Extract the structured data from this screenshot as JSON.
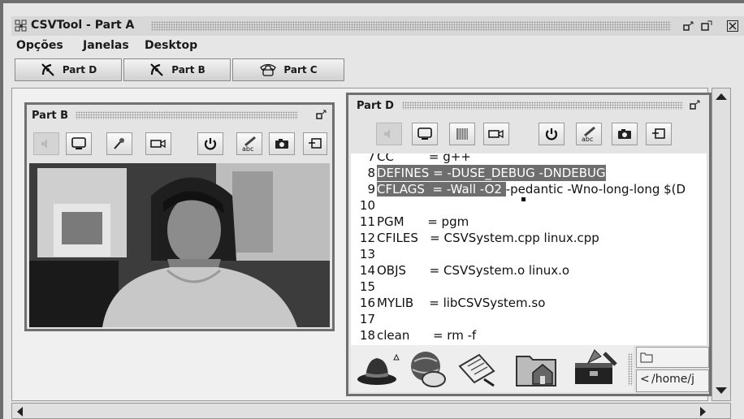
{
  "app": {
    "title": "CSVTool - Part A"
  },
  "menu": {
    "items": [
      {
        "label": "Opções"
      },
      {
        "label": "Janelas"
      },
      {
        "label": "Desktop"
      }
    ]
  },
  "tabs": [
    {
      "label": "Part D",
      "icon": "satellite-dish-icon"
    },
    {
      "label": "Part B",
      "icon": "satellite-dish-icon"
    },
    {
      "label": "Part C",
      "icon": "phone-icon"
    }
  ],
  "partB": {
    "title": "Part B",
    "tools": [
      "speaker-icon",
      "monitor-icon",
      "microphone-icon",
      "camera-icon",
      "power-icon",
      "spellcheck-icon",
      "snapshot-icon",
      "exit-icon"
    ]
  },
  "partD": {
    "title": "Part D",
    "tools": [
      "speaker-icon",
      "monitor-icon",
      "piano-icon",
      "camera-icon",
      "power-icon",
      "spellcheck-icon",
      "snapshot-icon",
      "exit-icon"
    ],
    "lines": [
      {
        "num": "7",
        "text": "CC         = g++"
      },
      {
        "num": "8",
        "text": "DEFINES = -DUSE_DEBUG -DNDEBUG"
      },
      {
        "num": "9",
        "text_hl": "CFLAGS  = -Wall -O2 ",
        "text": "-pedantic -Wno-long-long $(D"
      },
      {
        "num": "10",
        "text": ""
      },
      {
        "num": "11",
        "text": "PGM      = pgm"
      },
      {
        "num": "12",
        "text": "CFILES   = CSVSystem.cpp linux.cpp"
      },
      {
        "num": "13",
        "text": ""
      },
      {
        "num": "14",
        "text": "OBJS      = CSVSystem.o linux.o"
      },
      {
        "num": "15",
        "text": ""
      },
      {
        "num": "16",
        "text": "MYLIB    = libCSVSystem.so"
      },
      {
        "num": "17",
        "text": ""
      },
      {
        "num": "18",
        "text": "clean      = rm -f"
      }
    ],
    "dock": [
      "hat-icon",
      "globe-mouse-icon",
      "notepad-icon",
      "home-folder-icon",
      "toolbox-icon"
    ],
    "path": "/home/j"
  }
}
